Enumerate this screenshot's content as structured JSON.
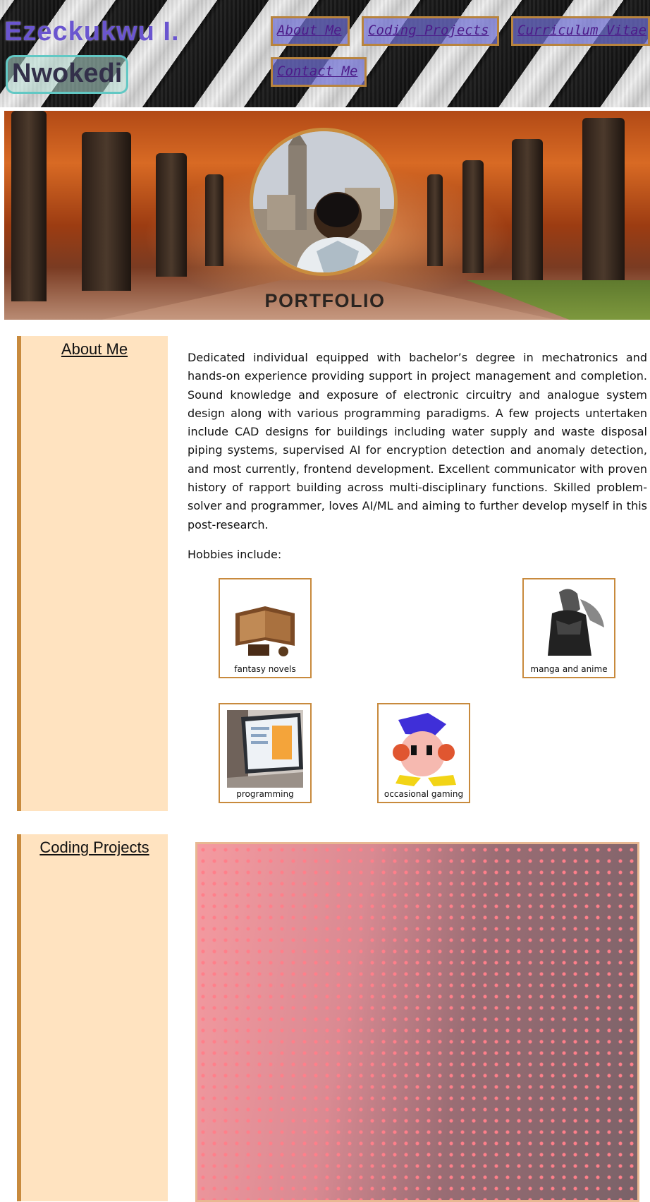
{
  "header": {
    "name_first": "Ezeckukwu I.",
    "name_last": "Nwokedi",
    "nav": [
      {
        "label": "About Me"
      },
      {
        "label": "Coding Projects"
      },
      {
        "label": "Curriculum Vitae"
      },
      {
        "label": "Contact Me"
      }
    ]
  },
  "hero": {
    "title": "PORTFOLIO"
  },
  "about": {
    "heading": "About Me",
    "paragraph": "Dedicated individual equipped with bachelor’s degree in mechatronics and hands-on experience providing support in project management and completion. Sound knowledge and exposure of electronic circuitry and analogue system design along with various programming paradigms. A few projects untertaken include CAD designs for buildings including water supply and waste disposal piping systems, supervised AI for encryption detection and anomaly detection, and most currently, frontend development. Excellent communicator with proven history of rapport building across multi-disciplinary functions. Skilled problem-solver and programmer, loves AI/ML and aiming to further develop myself in this post-research.",
    "hobbies_label": "Hobbies include:",
    "hobbies": [
      {
        "caption": "fantasy novels"
      },
      {
        "caption": "manga and anime"
      },
      {
        "caption": "programming"
      },
      {
        "caption": "occasional gaming"
      }
    ]
  },
  "projects": {
    "heading": "Coding Projects"
  },
  "colors": {
    "accent": "#c88a3d",
    "sidebar_bg": "#ffe3c0",
    "nav_text": "#4d1b8a",
    "name_purple": "#6a55cf",
    "name_teal_border": "#62c8c4"
  }
}
